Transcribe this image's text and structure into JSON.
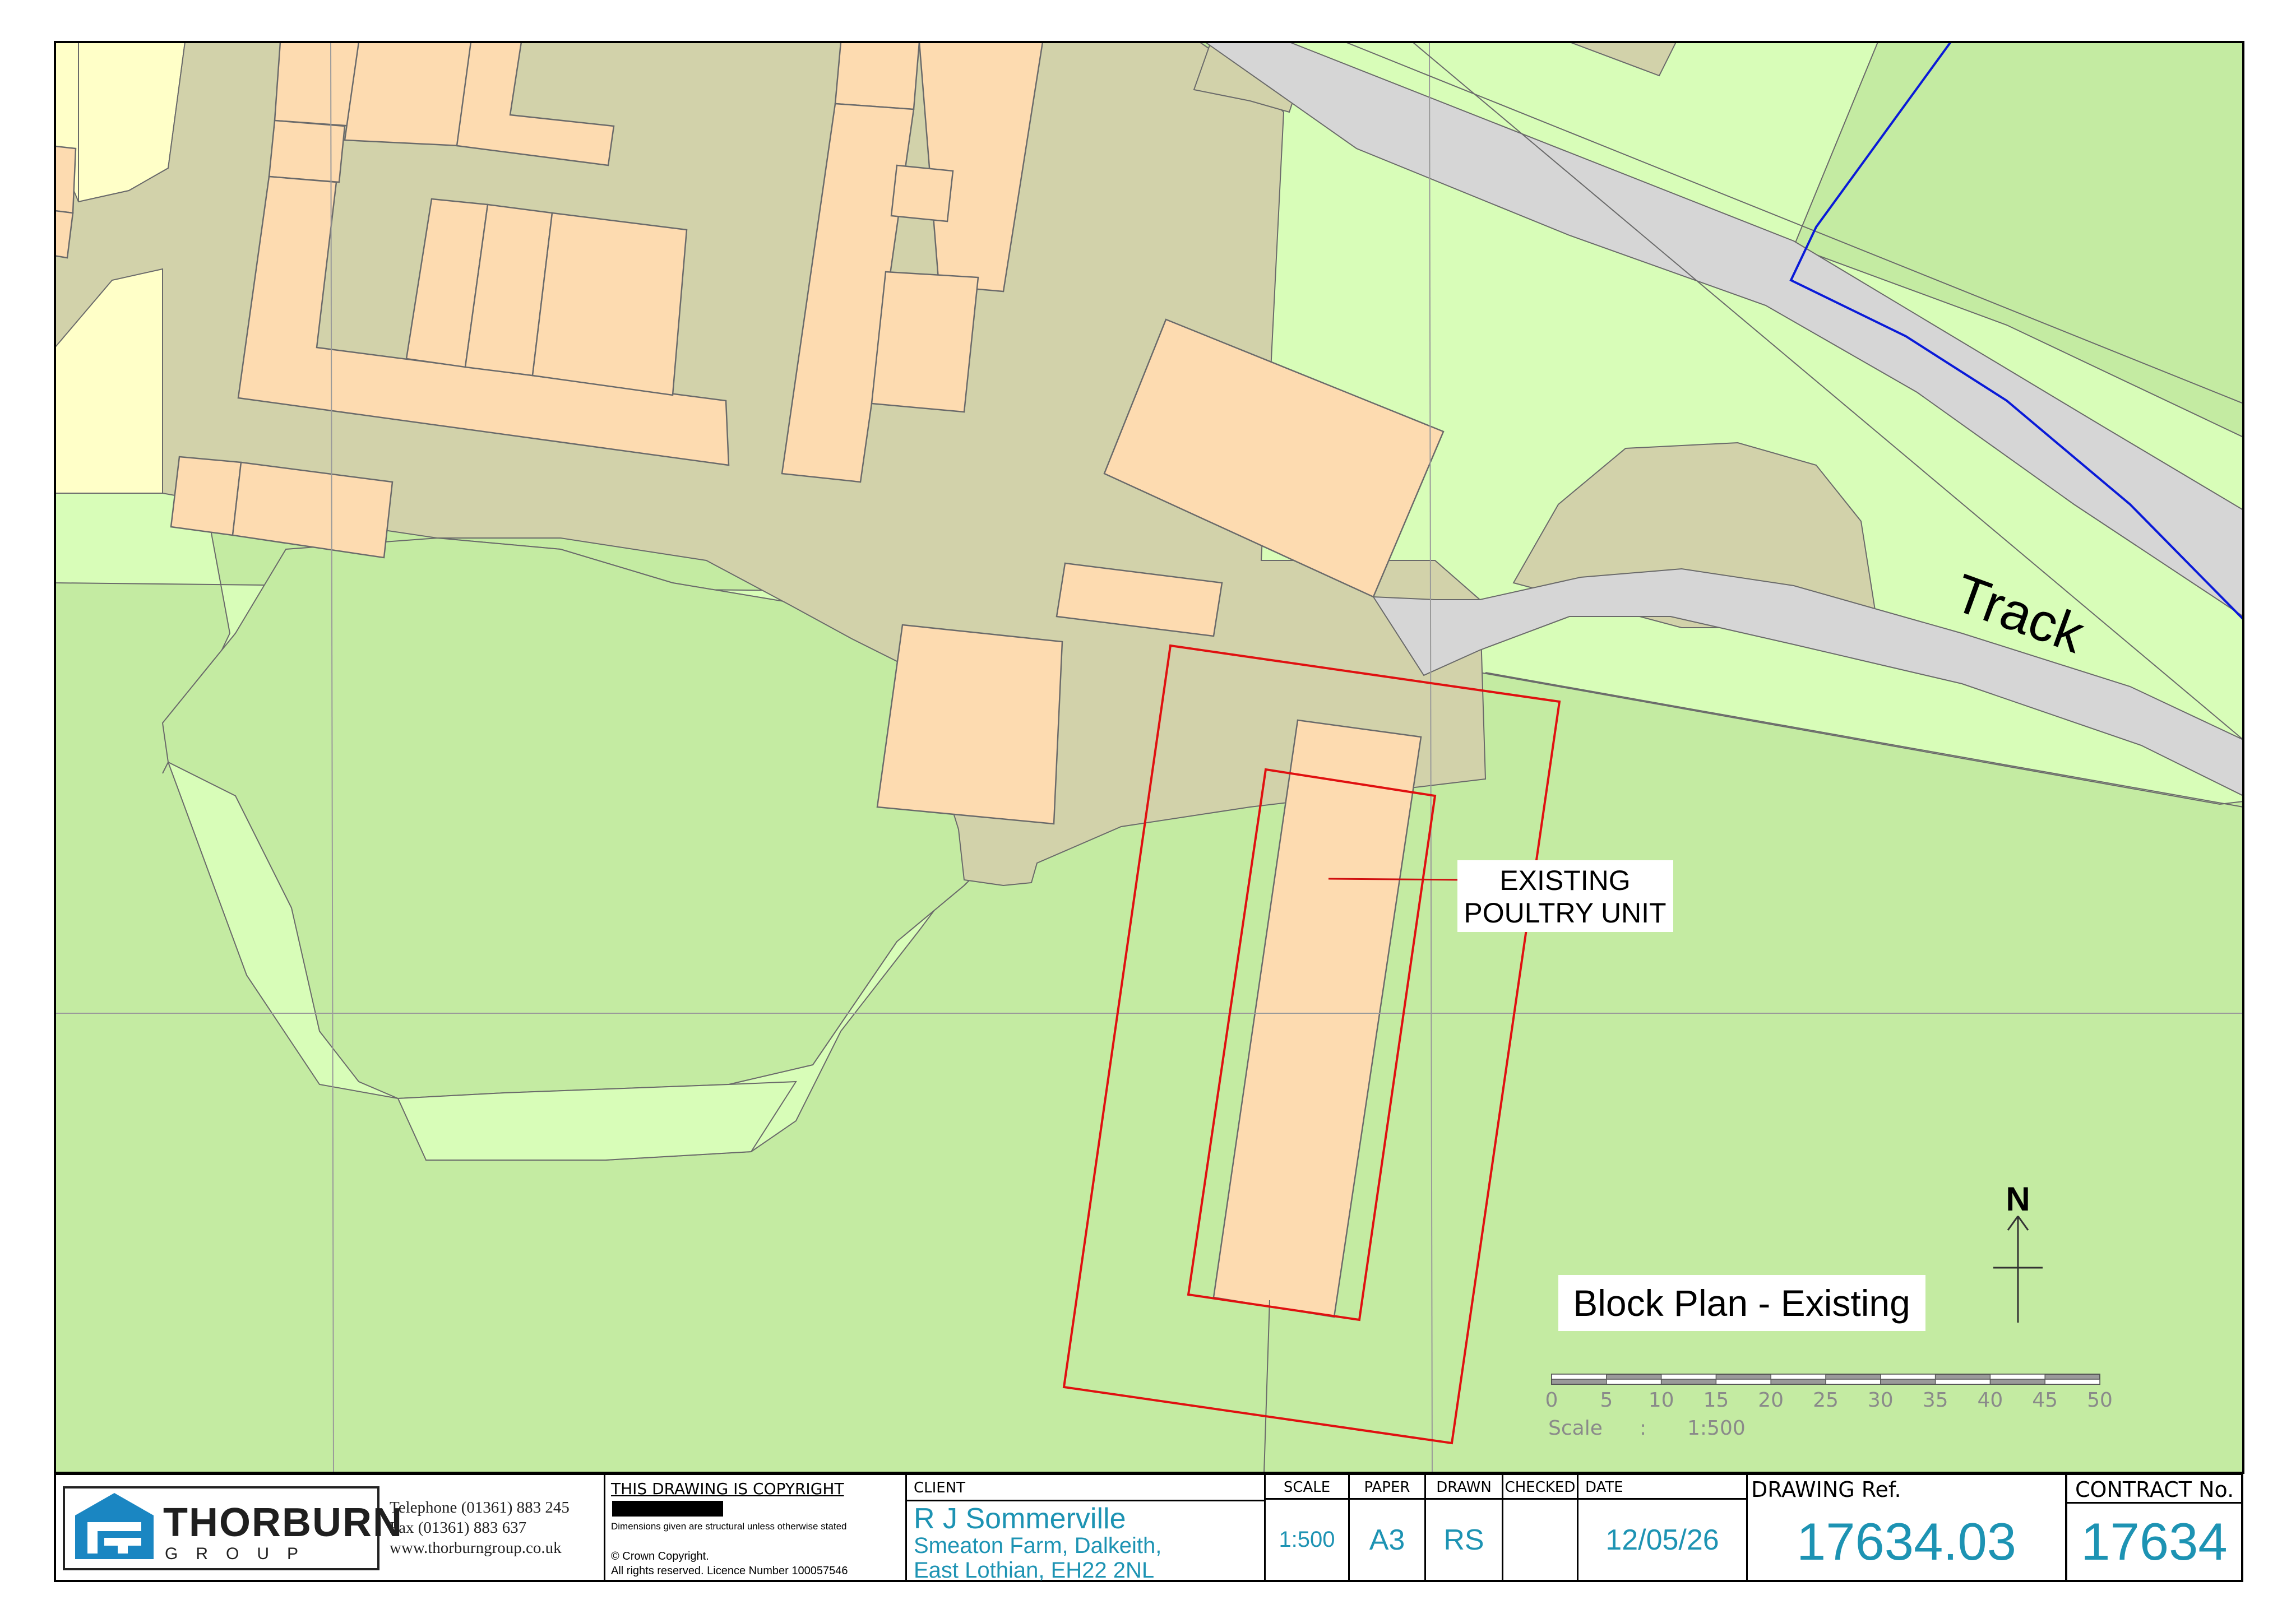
{
  "map": {
    "track_label": "Track",
    "callout": {
      "line1": "EXISTING",
      "line2": "POULTRY UNIT"
    },
    "plan_title": "Block Plan - Existing",
    "north_label": "N",
    "scale_bar": {
      "ticks": [
        "0",
        "5",
        "10",
        "15",
        "20",
        "25",
        "30",
        "35",
        "40",
        "45",
        "50"
      ],
      "scale_label": "Scale",
      "scale_separator": ":",
      "scale_value": "1:500"
    },
    "colors": {
      "building": "#fddbb0",
      "yard": "#d2d2aa",
      "grass_dark": "#c4eba2",
      "grass_light": "#d8fdb8",
      "garden": "#ffffc8",
      "track": "#d6d6d6",
      "site_boundary": "#e01010",
      "ownership_line": "#0a1ad8"
    }
  },
  "title_block": {
    "company_name": "THORBURN",
    "company_sub": "GROUP",
    "telephone": "Telephone (01361) 883 245",
    "fax": "Fax (01361) 883 637",
    "website": "www.thorburngroup.co.uk",
    "copyright_heading": "THIS DRAWING IS COPYRIGHT",
    "dimensions_note": "Dimensions given are structural unless otherwise stated",
    "crown_copyright": "© Crown Copyright.",
    "licence": "All rights reserved. Licence Number 100057546",
    "client_heading": "CLIENT",
    "client_name": "R J Sommerville",
    "client_address_1": "Smeaton Farm, Dalkeith,",
    "client_address_2": "East Lothian, EH22 2NL",
    "scale_heading": "SCALE",
    "scale_value": "1:500",
    "paper_heading": "PAPER",
    "paper_value": "A3",
    "drawn_heading": "DRAWN",
    "drawn_value": "RS",
    "checked_heading": "CHECKED",
    "checked_value": "",
    "date_heading": "DATE",
    "date_value": "12/05/26",
    "drawing_ref_heading": "DRAWING Ref.",
    "drawing_ref_value": "17634.03",
    "contract_heading": "CONTRACT No.",
    "contract_value": "17634"
  }
}
